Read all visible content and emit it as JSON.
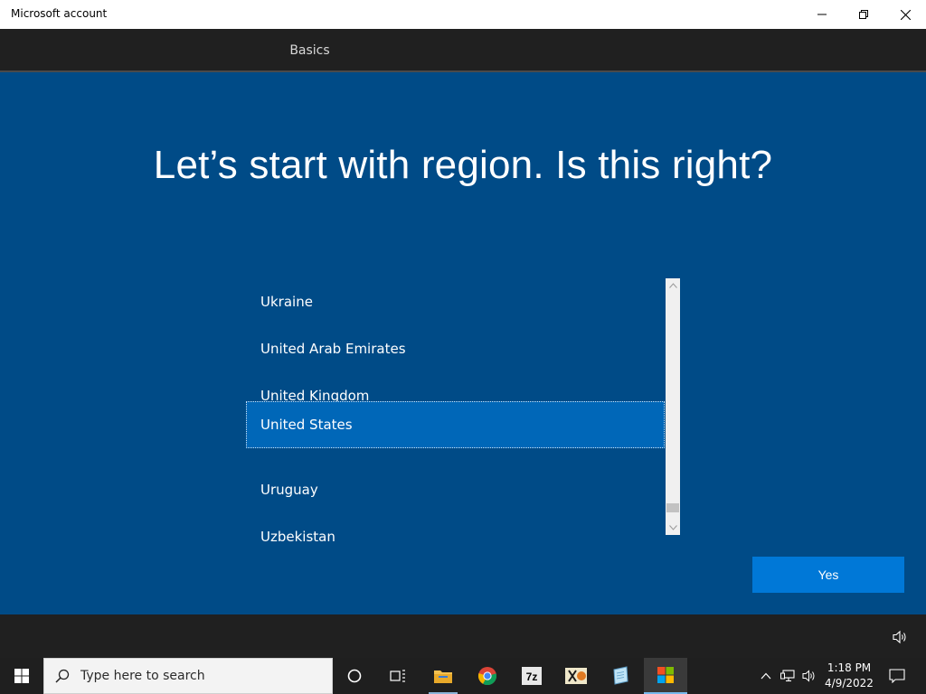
{
  "window": {
    "title": "Microsoft account",
    "minimize_icon": "minimize-icon",
    "restore_icon": "restore-icon",
    "close_icon": "close-icon"
  },
  "tabs": [
    {
      "label": "Basics",
      "active": true
    }
  ],
  "main": {
    "heading": "Let’s start with region. Is this right?",
    "regions": [
      "Ukraine",
      "United Arab Emirates",
      "United Kingdom",
      "United States",
      "Uruguay",
      "Uzbekistan"
    ],
    "selected_region": "United States",
    "yes_label": "Yes"
  },
  "colors": {
    "background": "#004b87",
    "selected_item": "#0067b8",
    "button": "#0078d7",
    "bar": "#202020"
  },
  "taskbar": {
    "search_placeholder": "Type here to search",
    "apps": [
      "task-view-icon",
      "file-explorer-icon",
      "chrome-icon",
      "7zip-icon",
      "xd-app-icon",
      "notepad-icon",
      "microsoft-store-icon"
    ],
    "time": "1:18 PM",
    "date": "4/9/2022"
  }
}
